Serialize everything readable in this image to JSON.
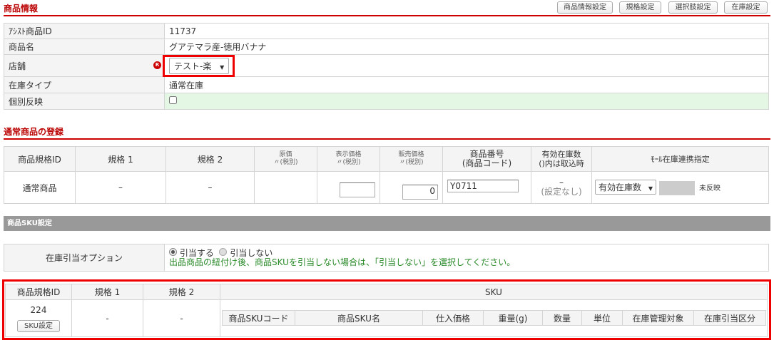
{
  "section1": {
    "title": "商品情報",
    "buttons": [
      "商品情報設定",
      "規格設定",
      "選択肢設定",
      "在庫設定"
    ],
    "rows": [
      {
        "label": "ｱｼｽﾄ商品ID",
        "value": "11737"
      },
      {
        "label": "商品名",
        "value": "グアテマラ産-徳用バナナ"
      },
      {
        "label": "店舗",
        "value": "テスト-楽",
        "badge": "R"
      },
      {
        "label": "在庫タイプ",
        "value": "通常在庫"
      },
      {
        "label": "個別反映",
        "value": ""
      }
    ]
  },
  "section2": {
    "title": "通常商品の登録",
    "headers": {
      "id": "商品規格ID",
      "spec1": "規格 1",
      "spec2": "規格 2",
      "cost": "原価",
      "cost_sub": "〃(税別)",
      "display": "表示価格",
      "display_sub": "〃(税別)",
      "sale": "販売価格",
      "sale_sub": "〃(税別)",
      "code": "商品番号",
      "code_sub": "(商品コード)",
      "stock": "有効在庫数",
      "stock_sub": "()内は取込時",
      "mall": "ﾓｰﾙ在庫連携指定"
    },
    "row": {
      "id": "通常商品",
      "spec1": "–",
      "spec2": "–",
      "cost": "",
      "display_price": "",
      "sale_price": "0",
      "code": "Y0711",
      "stock": "–",
      "stock_sub": "(設定なし)",
      "mall_select": "有効在庫数",
      "mall_status": "未反映"
    }
  },
  "section3": {
    "title": "商品SKU設定",
    "option_label": "在庫引当オプション",
    "radio1": "引当する",
    "radio2": "引当しない",
    "note": "出品商品の紐付け後、商品SKUを引当しない場合は、「引当しない」を選択してください。",
    "headers": {
      "id": "商品規格ID",
      "spec1": "規格 1",
      "spec2": "規格 2",
      "sku": "SKU"
    },
    "row": {
      "id": "224",
      "button": "SKU設定",
      "spec1": "-",
      "spec2": "-"
    },
    "sku_headers": [
      "商品SKUコード",
      "商品SKU名",
      "仕入価格",
      "重量(g)",
      "数量",
      "単位",
      "在庫管理対象",
      "在庫引当区分"
    ]
  }
}
